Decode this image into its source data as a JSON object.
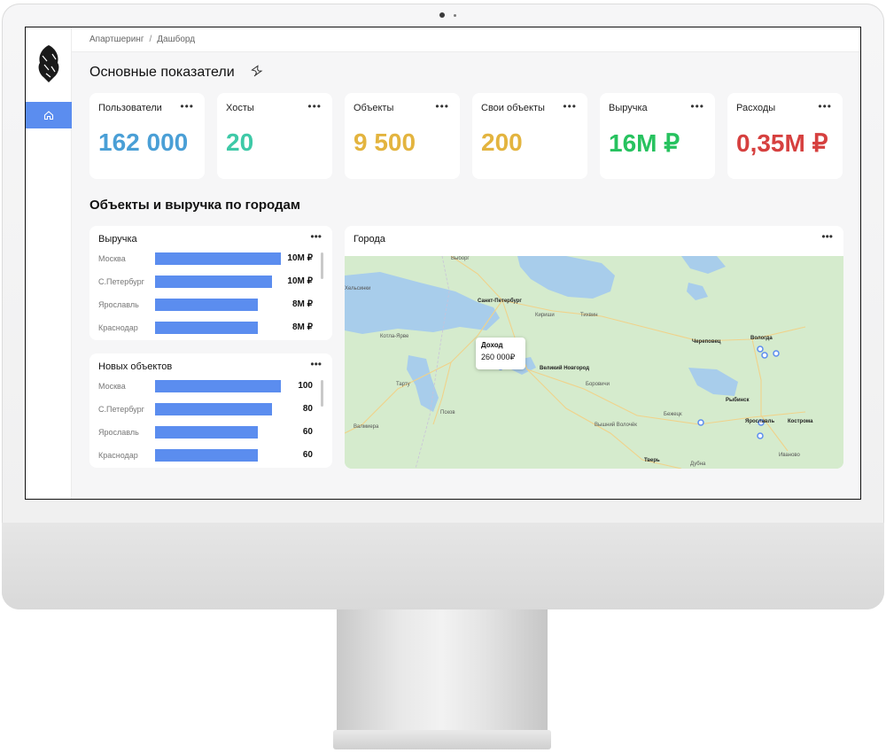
{
  "breadcrumb": {
    "root": "Апартшеринг",
    "separator": "/",
    "current": "Дашборд"
  },
  "sections": {
    "main_metrics": "Основные показатели",
    "by_city": "Объекты и выручка по городам"
  },
  "kpis": [
    {
      "label": "Пользователи",
      "value": "162 000",
      "color": "#4a9fd6"
    },
    {
      "label": "Хосты",
      "value": "20",
      "color": "#3ec9a7"
    },
    {
      "label": "Объекты",
      "value": "9 500",
      "color": "#e3b43f"
    },
    {
      "label": "Свои объекты",
      "value": "200",
      "color": "#e3b43f"
    },
    {
      "label": "Выручка",
      "value": "16M ₽",
      "color": "#27c25f"
    },
    {
      "label": "Расходы",
      "value": "0,35M ₽",
      "color": "#d6403f"
    }
  ],
  "more_glyph": "•••",
  "revenue_panel": {
    "title": "Выручка",
    "rows": [
      {
        "city": "Москва",
        "value": "10M ₽",
        "fraction": 1.0
      },
      {
        "city": "С.Петербург",
        "value": "10M ₽",
        "fraction": 0.93
      },
      {
        "city": "Ярославль",
        "value": "8M ₽",
        "fraction": 0.82
      },
      {
        "city": "Краснодар",
        "value": "8M ₽",
        "fraction": 0.82
      }
    ]
  },
  "new_objects_panel": {
    "title": "Новых объектов",
    "rows": [
      {
        "city": "Москва",
        "value": "100",
        "fraction": 1.0
      },
      {
        "city": "С.Петербург",
        "value": "80",
        "fraction": 0.93
      },
      {
        "city": "Ярославль",
        "value": "60",
        "fraction": 0.82
      },
      {
        "city": "Краснодар",
        "value": "60",
        "fraction": 0.82
      }
    ]
  },
  "map_panel": {
    "title": "Города",
    "tooltip": {
      "label": "Доход",
      "value": "260 000₽"
    },
    "labels": [
      "Выборг",
      "Хельсинки",
      "Санкт-Петербург",
      "Кириши",
      "Тихвин",
      "Котла-Ярве",
      "Великий Новгород",
      "Тарту",
      "Боровичи",
      "Череповец",
      "Вологда",
      "Рыбинск",
      "Псков",
      "Бежецк",
      "Вышний Волочёк",
      "Ярославль",
      "Кострома",
      "Валмиера",
      "Иваново",
      "Тверь",
      "Дубна"
    ]
  }
}
